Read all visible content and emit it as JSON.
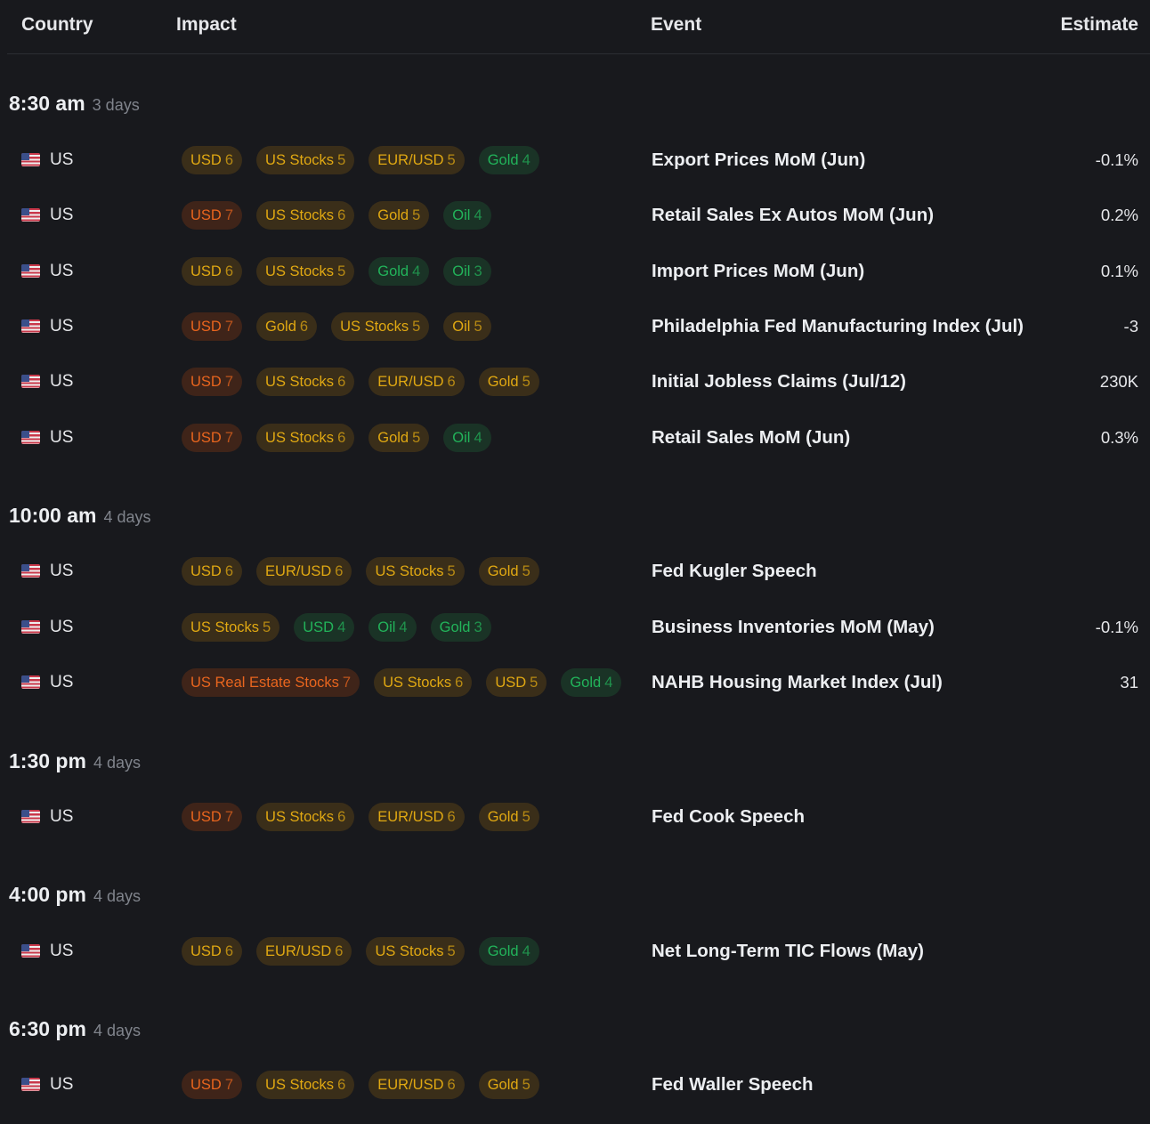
{
  "header": {
    "country": "Country",
    "impact": "Impact",
    "event": "Event",
    "estimate": "Estimate"
  },
  "colors": {
    "high": "#e8651e",
    "medium": "#e0a812",
    "low": "#22b35a",
    "background": "#18191d"
  },
  "groups": [
    {
      "time": "8:30 am",
      "days": "3 days",
      "rows": [
        {
          "country": "US",
          "event": "Export Prices MoM (Jun)",
          "estimate": "-0.1%",
          "chips": [
            [
              "USD",
              "6",
              "y"
            ],
            [
              "US Stocks",
              "5",
              "y"
            ],
            [
              "EUR/USD",
              "5",
              "y"
            ],
            [
              "Gold",
              "4",
              "g"
            ]
          ]
        },
        {
          "country": "US",
          "event": "Retail Sales Ex Autos MoM (Jun)",
          "estimate": "0.2%",
          "chips": [
            [
              "USD",
              "7",
              "o"
            ],
            [
              "US Stocks",
              "6",
              "y"
            ],
            [
              "Gold",
              "5",
              "y"
            ],
            [
              "Oil",
              "4",
              "g"
            ]
          ]
        },
        {
          "country": "US",
          "event": "Import Prices MoM (Jun)",
          "estimate": "0.1%",
          "chips": [
            [
              "USD",
              "6",
              "y"
            ],
            [
              "US Stocks",
              "5",
              "y"
            ],
            [
              "Gold",
              "4",
              "g"
            ],
            [
              "Oil",
              "3",
              "g"
            ]
          ]
        },
        {
          "country": "US",
          "event": "Philadelphia Fed Manufacturing Index (Jul)",
          "estimate": "-3",
          "chips": [
            [
              "USD",
              "7",
              "o"
            ],
            [
              "Gold",
              "6",
              "y"
            ],
            [
              "US Stocks",
              "5",
              "y"
            ],
            [
              "Oil",
              "5",
              "y"
            ]
          ]
        },
        {
          "country": "US",
          "event": "Initial Jobless Claims (Jul/12)",
          "estimate": "230K",
          "chips": [
            [
              "USD",
              "7",
              "o"
            ],
            [
              "US Stocks",
              "6",
              "y"
            ],
            [
              "EUR/USD",
              "6",
              "y"
            ],
            [
              "Gold",
              "5",
              "y"
            ]
          ]
        },
        {
          "country": "US",
          "event": "Retail Sales MoM (Jun)",
          "estimate": "0.3%",
          "chips": [
            [
              "USD",
              "7",
              "o"
            ],
            [
              "US Stocks",
              "6",
              "y"
            ],
            [
              "Gold",
              "5",
              "y"
            ],
            [
              "Oil",
              "4",
              "g"
            ]
          ]
        }
      ]
    },
    {
      "time": "10:00 am",
      "days": "4 days",
      "rows": [
        {
          "country": "US",
          "event": "Fed Kugler Speech",
          "estimate": "",
          "chips": [
            [
              "USD",
              "6",
              "y"
            ],
            [
              "EUR/USD",
              "6",
              "y"
            ],
            [
              "US Stocks",
              "5",
              "y"
            ],
            [
              "Gold",
              "5",
              "y"
            ]
          ]
        },
        {
          "country": "US",
          "event": "Business Inventories MoM (May)",
          "estimate": "-0.1%",
          "chips": [
            [
              "US Stocks",
              "5",
              "y"
            ],
            [
              "USD",
              "4",
              "g"
            ],
            [
              "Oil",
              "4",
              "g"
            ],
            [
              "Gold",
              "3",
              "g"
            ]
          ]
        },
        {
          "country": "US",
          "event": "NAHB Housing Market Index (Jul)",
          "estimate": "31",
          "chips": [
            [
              "US Real Estate Stocks",
              "7",
              "o"
            ],
            [
              "US Stocks",
              "6",
              "y"
            ],
            [
              "USD",
              "5",
              "y"
            ],
            [
              "Gold",
              "4",
              "g"
            ]
          ]
        }
      ]
    },
    {
      "time": "1:30 pm",
      "days": "4 days",
      "rows": [
        {
          "country": "US",
          "event": "Fed Cook Speech",
          "estimate": "",
          "chips": [
            [
              "USD",
              "7",
              "o"
            ],
            [
              "US Stocks",
              "6",
              "y"
            ],
            [
              "EUR/USD",
              "6",
              "y"
            ],
            [
              "Gold",
              "5",
              "y"
            ]
          ]
        }
      ]
    },
    {
      "time": "4:00 pm",
      "days": "4 days",
      "rows": [
        {
          "country": "US",
          "event": "Net Long-Term TIC Flows (May)",
          "estimate": "",
          "chips": [
            [
              "USD",
              "6",
              "y"
            ],
            [
              "EUR/USD",
              "6",
              "y"
            ],
            [
              "US Stocks",
              "5",
              "y"
            ],
            [
              "Gold",
              "4",
              "g"
            ]
          ]
        }
      ]
    },
    {
      "time": "6:30 pm",
      "days": "4 days",
      "rows": [
        {
          "country": "US",
          "event": "Fed Waller Speech",
          "estimate": "",
          "chips": [
            [
              "USD",
              "7",
              "o"
            ],
            [
              "US Stocks",
              "6",
              "y"
            ],
            [
              "EUR/USD",
              "6",
              "y"
            ],
            [
              "Gold",
              "5",
              "y"
            ]
          ]
        }
      ]
    }
  ]
}
